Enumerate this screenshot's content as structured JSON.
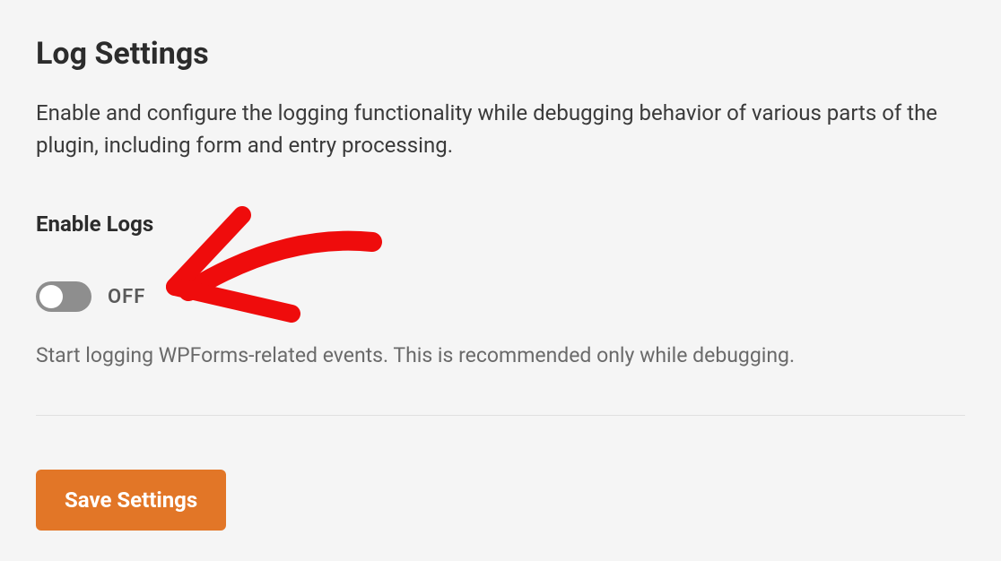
{
  "section": {
    "title": "Log Settings",
    "description": "Enable and configure the logging functionality while debugging behavior of various parts of the plugin, including form and entry processing."
  },
  "field": {
    "label": "Enable Logs",
    "toggle_state": "OFF",
    "help": "Start logging WPForms-related events. This is recommended only while debugging."
  },
  "actions": {
    "save_label": "Save Settings"
  },
  "colors": {
    "primary": "#e27627",
    "toggle_off": "#8e8e8e",
    "annotation": "#ef0c0c"
  }
}
